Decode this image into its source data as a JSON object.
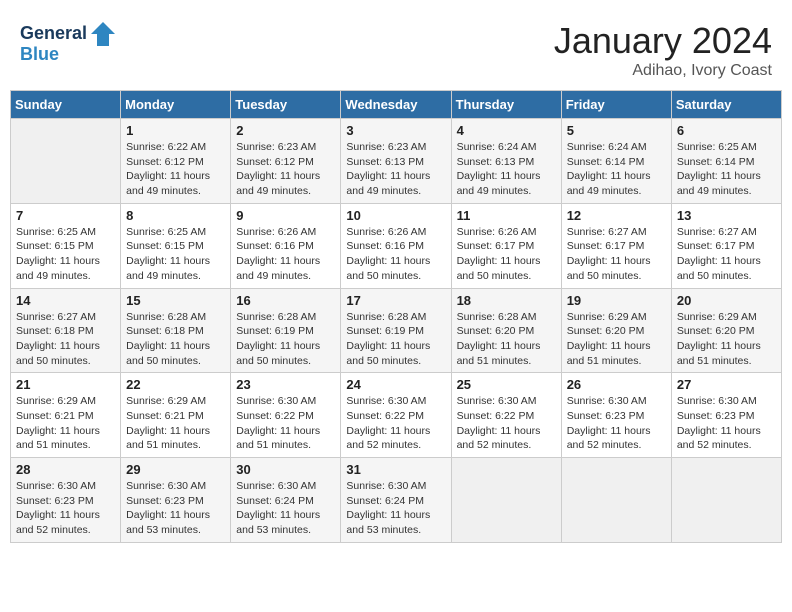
{
  "logo": {
    "line1": "General",
    "line2": "Blue"
  },
  "header": {
    "month": "January 2024",
    "location": "Adihao, Ivory Coast"
  },
  "weekdays": [
    "Sunday",
    "Monday",
    "Tuesday",
    "Wednesday",
    "Thursday",
    "Friday",
    "Saturday"
  ],
  "weeks": [
    [
      {
        "day": "",
        "empty": true
      },
      {
        "day": "1",
        "sunrise": "Sunrise: 6:22 AM",
        "sunset": "Sunset: 6:12 PM",
        "daylight": "Daylight: 11 hours and 49 minutes."
      },
      {
        "day": "2",
        "sunrise": "Sunrise: 6:23 AM",
        "sunset": "Sunset: 6:12 PM",
        "daylight": "Daylight: 11 hours and 49 minutes."
      },
      {
        "day": "3",
        "sunrise": "Sunrise: 6:23 AM",
        "sunset": "Sunset: 6:13 PM",
        "daylight": "Daylight: 11 hours and 49 minutes."
      },
      {
        "day": "4",
        "sunrise": "Sunrise: 6:24 AM",
        "sunset": "Sunset: 6:13 PM",
        "daylight": "Daylight: 11 hours and 49 minutes."
      },
      {
        "day": "5",
        "sunrise": "Sunrise: 6:24 AM",
        "sunset": "Sunset: 6:14 PM",
        "daylight": "Daylight: 11 hours and 49 minutes."
      },
      {
        "day": "6",
        "sunrise": "Sunrise: 6:25 AM",
        "sunset": "Sunset: 6:14 PM",
        "daylight": "Daylight: 11 hours and 49 minutes."
      }
    ],
    [
      {
        "day": "7",
        "sunrise": "Sunrise: 6:25 AM",
        "sunset": "Sunset: 6:15 PM",
        "daylight": "Daylight: 11 hours and 49 minutes."
      },
      {
        "day": "8",
        "sunrise": "Sunrise: 6:25 AM",
        "sunset": "Sunset: 6:15 PM",
        "daylight": "Daylight: 11 hours and 49 minutes."
      },
      {
        "day": "9",
        "sunrise": "Sunrise: 6:26 AM",
        "sunset": "Sunset: 6:16 PM",
        "daylight": "Daylight: 11 hours and 49 minutes."
      },
      {
        "day": "10",
        "sunrise": "Sunrise: 6:26 AM",
        "sunset": "Sunset: 6:16 PM",
        "daylight": "Daylight: 11 hours and 50 minutes."
      },
      {
        "day": "11",
        "sunrise": "Sunrise: 6:26 AM",
        "sunset": "Sunset: 6:17 PM",
        "daylight": "Daylight: 11 hours and 50 minutes."
      },
      {
        "day": "12",
        "sunrise": "Sunrise: 6:27 AM",
        "sunset": "Sunset: 6:17 PM",
        "daylight": "Daylight: 11 hours and 50 minutes."
      },
      {
        "day": "13",
        "sunrise": "Sunrise: 6:27 AM",
        "sunset": "Sunset: 6:17 PM",
        "daylight": "Daylight: 11 hours and 50 minutes."
      }
    ],
    [
      {
        "day": "14",
        "sunrise": "Sunrise: 6:27 AM",
        "sunset": "Sunset: 6:18 PM",
        "daylight": "Daylight: 11 hours and 50 minutes."
      },
      {
        "day": "15",
        "sunrise": "Sunrise: 6:28 AM",
        "sunset": "Sunset: 6:18 PM",
        "daylight": "Daylight: 11 hours and 50 minutes."
      },
      {
        "day": "16",
        "sunrise": "Sunrise: 6:28 AM",
        "sunset": "Sunset: 6:19 PM",
        "daylight": "Daylight: 11 hours and 50 minutes."
      },
      {
        "day": "17",
        "sunrise": "Sunrise: 6:28 AM",
        "sunset": "Sunset: 6:19 PM",
        "daylight": "Daylight: 11 hours and 50 minutes."
      },
      {
        "day": "18",
        "sunrise": "Sunrise: 6:28 AM",
        "sunset": "Sunset: 6:20 PM",
        "daylight": "Daylight: 11 hours and 51 minutes."
      },
      {
        "day": "19",
        "sunrise": "Sunrise: 6:29 AM",
        "sunset": "Sunset: 6:20 PM",
        "daylight": "Daylight: 11 hours and 51 minutes."
      },
      {
        "day": "20",
        "sunrise": "Sunrise: 6:29 AM",
        "sunset": "Sunset: 6:20 PM",
        "daylight": "Daylight: 11 hours and 51 minutes."
      }
    ],
    [
      {
        "day": "21",
        "sunrise": "Sunrise: 6:29 AM",
        "sunset": "Sunset: 6:21 PM",
        "daylight": "Daylight: 11 hours and 51 minutes."
      },
      {
        "day": "22",
        "sunrise": "Sunrise: 6:29 AM",
        "sunset": "Sunset: 6:21 PM",
        "daylight": "Daylight: 11 hours and 51 minutes."
      },
      {
        "day": "23",
        "sunrise": "Sunrise: 6:30 AM",
        "sunset": "Sunset: 6:22 PM",
        "daylight": "Daylight: 11 hours and 51 minutes."
      },
      {
        "day": "24",
        "sunrise": "Sunrise: 6:30 AM",
        "sunset": "Sunset: 6:22 PM",
        "daylight": "Daylight: 11 hours and 52 minutes."
      },
      {
        "day": "25",
        "sunrise": "Sunrise: 6:30 AM",
        "sunset": "Sunset: 6:22 PM",
        "daylight": "Daylight: 11 hours and 52 minutes."
      },
      {
        "day": "26",
        "sunrise": "Sunrise: 6:30 AM",
        "sunset": "Sunset: 6:23 PM",
        "daylight": "Daylight: 11 hours and 52 minutes."
      },
      {
        "day": "27",
        "sunrise": "Sunrise: 6:30 AM",
        "sunset": "Sunset: 6:23 PM",
        "daylight": "Daylight: 11 hours and 52 minutes."
      }
    ],
    [
      {
        "day": "28",
        "sunrise": "Sunrise: 6:30 AM",
        "sunset": "Sunset: 6:23 PM",
        "daylight": "Daylight: 11 hours and 52 minutes."
      },
      {
        "day": "29",
        "sunrise": "Sunrise: 6:30 AM",
        "sunset": "Sunset: 6:23 PM",
        "daylight": "Daylight: 11 hours and 53 minutes."
      },
      {
        "day": "30",
        "sunrise": "Sunrise: 6:30 AM",
        "sunset": "Sunset: 6:24 PM",
        "daylight": "Daylight: 11 hours and 53 minutes."
      },
      {
        "day": "31",
        "sunrise": "Sunrise: 6:30 AM",
        "sunset": "Sunset: 6:24 PM",
        "daylight": "Daylight: 11 hours and 53 minutes."
      },
      {
        "day": "",
        "empty": true
      },
      {
        "day": "",
        "empty": true
      },
      {
        "day": "",
        "empty": true
      }
    ]
  ]
}
